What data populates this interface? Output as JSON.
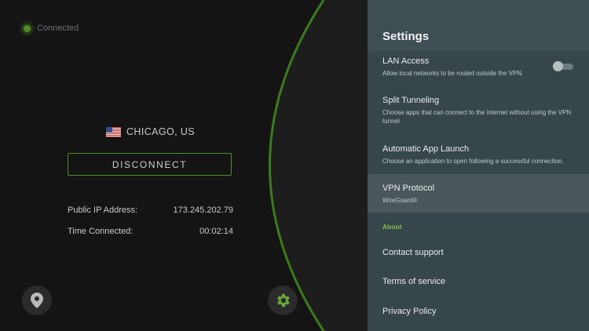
{
  "status": {
    "text": "Connected"
  },
  "connection": {
    "location": "CHICAGO, US",
    "disconnect_label": "DISCONNECT",
    "public_ip_label": "Public IP Address:",
    "public_ip_value": "173.245.202.79",
    "time_label": "Time Connected:",
    "time_value": "00:02:14"
  },
  "icons": {
    "location_button": "map-pin-icon",
    "settings_button": "gear-icon",
    "flag": "us-flag-icon"
  },
  "colors": {
    "accent": "#5a9a2a",
    "panel": "#37464b",
    "header": "#3e4e53"
  },
  "settings": {
    "title": "Settings",
    "lan_access": {
      "title": "LAN Access",
      "desc": "Allow local networks to be routed outside the VPN.",
      "enabled": false
    },
    "split_tunneling": {
      "title": "Split Tunneling",
      "desc": "Choose apps that can connect to the internet without using the VPN tunnel."
    },
    "auto_launch": {
      "title": "Automatic App Launch",
      "desc": "Choose an application to open following a successful connection."
    },
    "vpn_protocol": {
      "title": "VPN Protocol",
      "value": "WireGuard®"
    },
    "about_header": "About",
    "contact": "Contact support",
    "terms": "Terms of service",
    "privacy": "Privacy Policy"
  }
}
